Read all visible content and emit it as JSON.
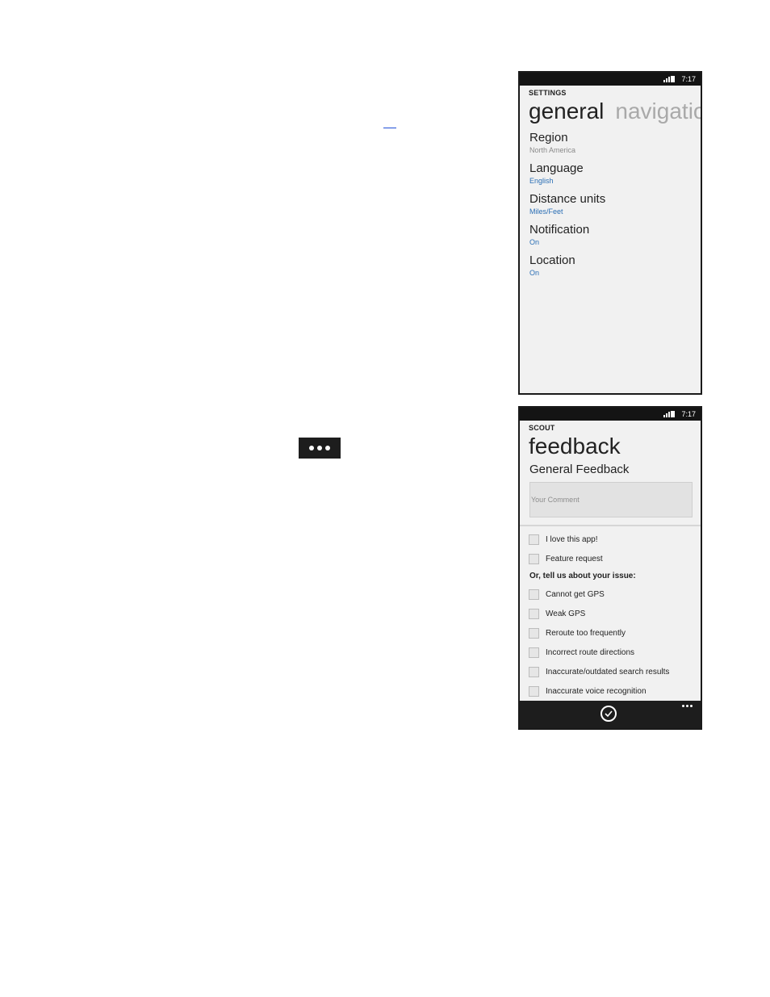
{
  "status_bar": {
    "time": "7:17"
  },
  "settings_screen": {
    "app_title": "SETTINGS",
    "pivot_active": "general",
    "pivot_next": "navigatio",
    "items": [
      {
        "name": "Region",
        "value": "North America"
      },
      {
        "name": "Language",
        "value": "English"
      },
      {
        "name": "Distance units",
        "value": "Miles/Feet"
      },
      {
        "name": "Notification",
        "value": "On"
      },
      {
        "name": "Location",
        "value": "On"
      }
    ]
  },
  "feedback_screen": {
    "app_title": "SCOUT",
    "title": "feedback",
    "subtitle": "General Feedback",
    "comment_placeholder": "Your Comment",
    "checkboxes_top": [
      "I love this app!",
      "Feature request"
    ],
    "issue_heading": "Or, tell us about your issue:",
    "checkboxes_issues": [
      "Cannot get GPS",
      "Weak GPS",
      "Reroute too frequently",
      "Incorrect route directions",
      "Inaccurate/outdated search results",
      "Inaccurate voice recognition"
    ]
  },
  "icons": {
    "more": "ellipsis-icon",
    "submit": "check-circle-icon",
    "signal": "signal-battery-icon"
  }
}
